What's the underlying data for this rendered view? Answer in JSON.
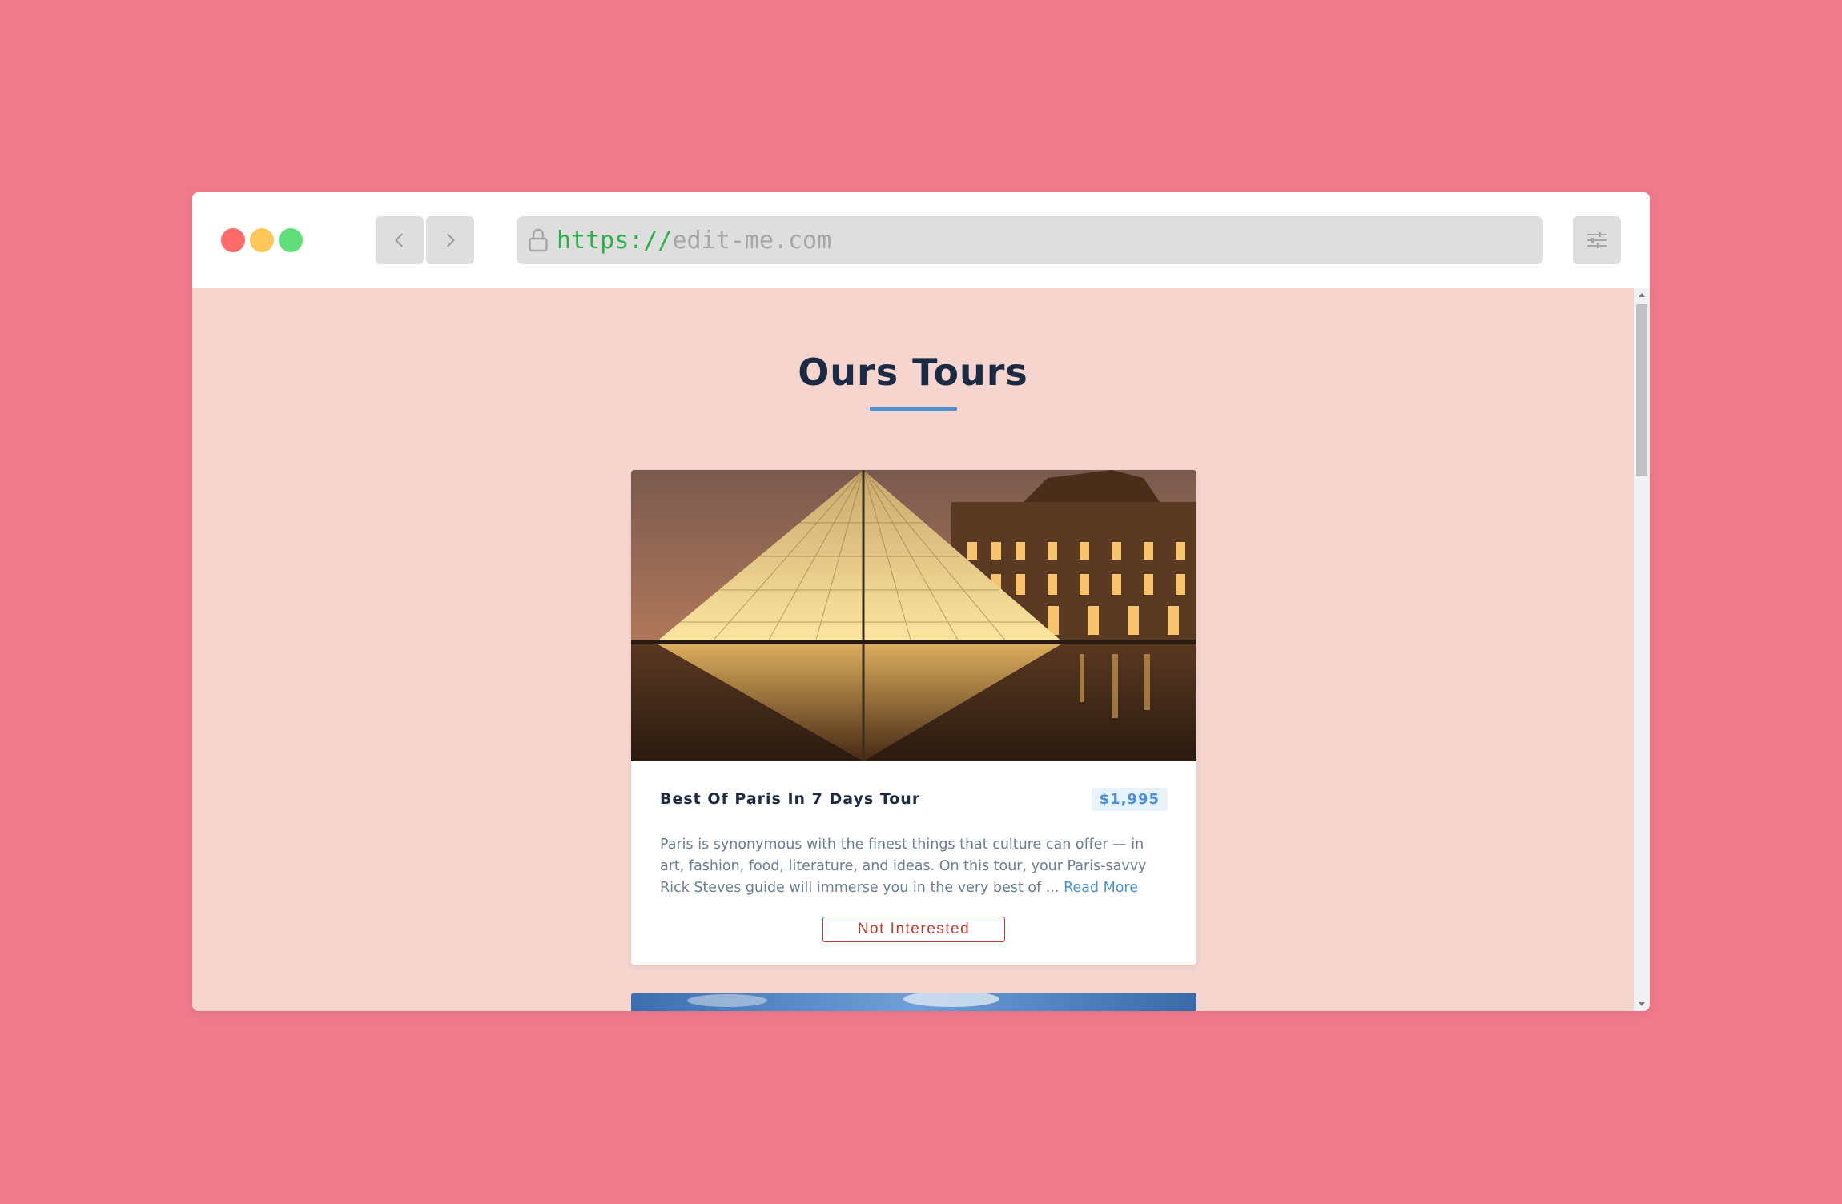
{
  "browser": {
    "url_scheme": "https://",
    "url_host": "edit-me.com"
  },
  "page": {
    "title": "Ours Tours"
  },
  "tours": [
    {
      "name": "Best Of Paris In 7 Days Tour",
      "price": "$1,995",
      "description": "Paris is synonymous with the finest things that culture can offer — in art, fashion, food, literature, and ideas. On this tour, your Paris-savvy Rick Steves guide will immerse you in the very best of ... ",
      "read_more": "Read More",
      "not_interested": "Not Interested"
    }
  ],
  "colors": {
    "background": "#f07a8c",
    "page": "#f6d5cf",
    "title": "#1b2b44",
    "accent": "#4a90d9",
    "danger": "#c0392b",
    "url_scheme": "#2bb14a"
  }
}
